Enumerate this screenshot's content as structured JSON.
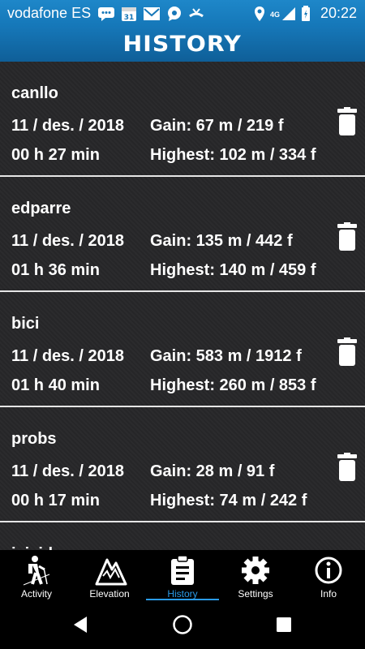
{
  "status_bar": {
    "carrier": "vodafone ES",
    "calendar_day": "31",
    "network": "4G",
    "time": "20:22"
  },
  "header": {
    "title": "HISTORY"
  },
  "entries": [
    {
      "name": "canllo",
      "date": "11 / des. / 2018",
      "gain": "Gain: 67 m / 219 f",
      "duration": "00 h 27 min",
      "highest": "Highest: 102 m / 334 f"
    },
    {
      "name": "edparre",
      "date": "11 / des. / 2018",
      "gain": "Gain: 135 m / 442 f",
      "duration": "01 h 36 min",
      "highest": "Highest: 140 m / 459 f"
    },
    {
      "name": "bici",
      "date": "11 / des. / 2018",
      "gain": "Gain: 583 m / 1912 f",
      "duration": "01 h 40 min",
      "highest": "Highest: 260 m / 853 f"
    },
    {
      "name": "probs",
      "date": "11 / des. / 2018",
      "gain": "Gain: 28 m / 91 f",
      "duration": "00 h 17 min",
      "highest": "Highest: 74 m / 242 f"
    },
    {
      "name": "jsjsjd",
      "date": "",
      "gain": "",
      "duration": "",
      "highest": ""
    }
  ],
  "nav": {
    "items": [
      {
        "label": "Activity",
        "icon": "hiker-icon"
      },
      {
        "label": "Elevation",
        "icon": "mountain-icon"
      },
      {
        "label": "History",
        "icon": "clipboard-icon"
      },
      {
        "label": "Settings",
        "icon": "gear-icon"
      },
      {
        "label": "Info",
        "icon": "info-icon"
      }
    ],
    "active": "History"
  },
  "colors": {
    "status_bar": "#1e87c9",
    "header": "#1677b8",
    "accent": "#2a9be8",
    "list_bg": "#2b2b2d"
  }
}
